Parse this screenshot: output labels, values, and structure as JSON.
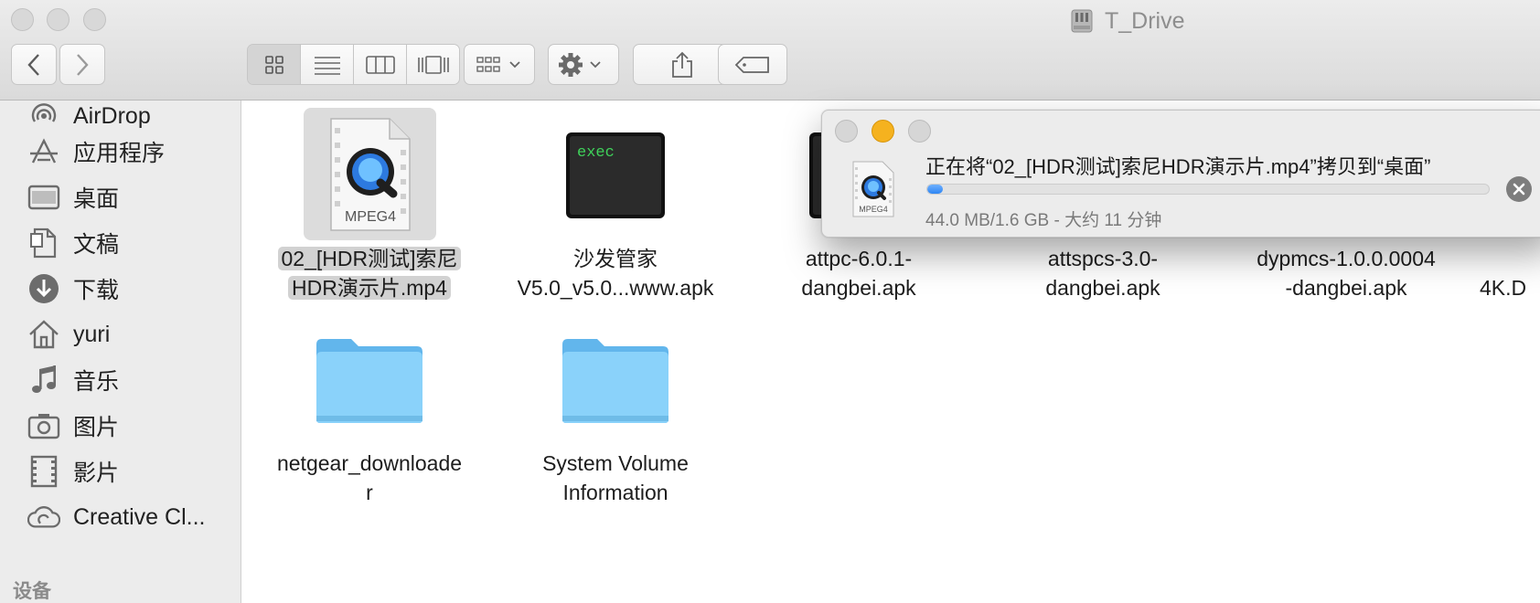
{
  "window": {
    "title": "T_Drive"
  },
  "toolbar": {
    "back_icon": "chevron-left-icon",
    "forward_icon": "chevron-right-icon",
    "view_modes": [
      "icon-view-icon",
      "list-view-icon",
      "column-view-icon",
      "cover-flow-icon"
    ],
    "arrange_icon": "grid-arrange-icon",
    "action_icon": "gear-icon",
    "share_icon": "share-icon",
    "tags_icon": "tag-icon"
  },
  "sidebar": {
    "items": [
      {
        "label": "AirDrop",
        "icon": "airdrop-icon"
      },
      {
        "label": "应用程序",
        "icon": "applications-icon"
      },
      {
        "label": "桌面",
        "icon": "desktop-icon"
      },
      {
        "label": "文稿",
        "icon": "documents-icon"
      },
      {
        "label": "下载",
        "icon": "downloads-icon"
      },
      {
        "label": "yuri",
        "icon": "home-icon"
      },
      {
        "label": "音乐",
        "icon": "music-icon"
      },
      {
        "label": "图片",
        "icon": "pictures-icon"
      },
      {
        "label": "影片",
        "icon": "movies-icon"
      },
      {
        "label": "Creative Cl...",
        "icon": "creative-cloud-icon"
      }
    ],
    "section_devices": "设备"
  },
  "files": [
    {
      "name": "02_[HDR测试]索尼HDR演示片.mp4",
      "line1": "02_[HDR测试]索尼",
      "line2": "HDR演示片.mp4",
      "badge": "MPEG4",
      "selected": true
    },
    {
      "name": "沙发管家 V5.0_v5.0...www.apk",
      "line1": "沙发管家",
      "line2": "V5.0_v5.0...www.apk",
      "badge": "exec"
    },
    {
      "line1": "attpc-6.0.1-",
      "line2": "dangbei.apk"
    },
    {
      "line1": "attspcs-3.0-",
      "line2": "dangbei.apk"
    },
    {
      "line1": "dypmcs-1.0.0.0004",
      "line2": "-dangbei.apk"
    },
    {
      "line1": "",
      "line2": "4K.D"
    },
    {
      "line1": "netgear_downloade",
      "line2": "r"
    },
    {
      "line1": "System Volume",
      "line2": "Information"
    }
  ],
  "copy_dialog": {
    "title": "正在将“02_[HDR测试]索尼HDR演示片.mp4”拷贝到“桌面”",
    "status": "44.0 MB/1.6 GB - 大约 11 分钟",
    "progress": 0.027,
    "file_badge": "MPEG4",
    "stop_icon": "close-circle-icon"
  },
  "colors": {
    "accent": "#2e86f3",
    "folder": "#7cc8f5",
    "minimize": "#f5b21f"
  }
}
